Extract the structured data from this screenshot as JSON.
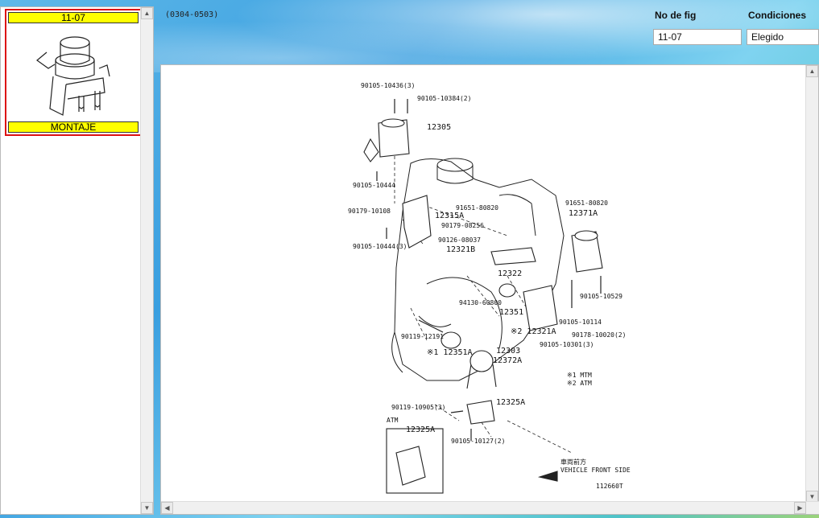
{
  "thumbnail": {
    "fig_number": "11-07",
    "caption": "MONTAJE"
  },
  "header": {
    "range": "(0304-0503)",
    "fig_label": "No de fig",
    "fig_value": "11-07",
    "cond_label": "Condiciones",
    "cond_value": "Elegido"
  },
  "diagram": {
    "labels": [
      "90105-10436(3)",
      "90105-10384(2)",
      "12305",
      "90105-10444",
      "90179-10108",
      "12315A",
      "90105-10444(3)",
      "91651-80820",
      "90179-08256",
      "90126-08037",
      "12321B",
      "91651-80820",
      "12371A",
      "12322",
      "94130-60800",
      "12351",
      "90105-10529",
      "90105-10114",
      "90178-10020(2)",
      "90119-12191",
      "※1 12351A",
      "※2 12321A",
      "12303",
      "12372A",
      "90105-10301(3)",
      "※1 MTM",
      "※2 ATM",
      "90119-10905(3)",
      "12325A",
      "ATM",
      "12325A",
      "90105-10127(2)",
      "車両前方",
      "VEHICLE FRONT SIDE",
      "112660T"
    ]
  }
}
